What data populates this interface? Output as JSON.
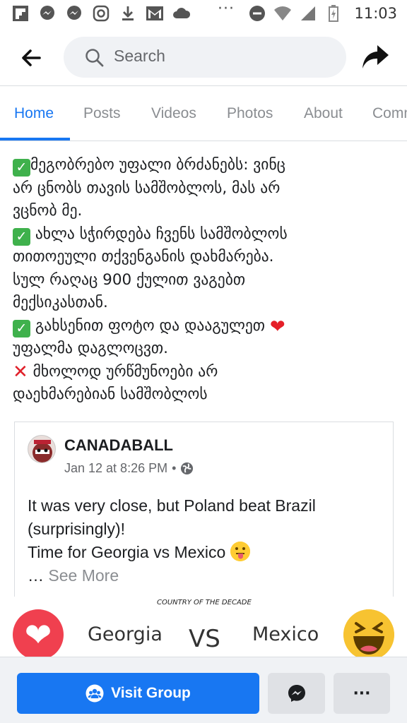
{
  "status_bar": {
    "time": "11:03",
    "dots": "···",
    "left_icons": [
      "flipboard-icon",
      "messenger-icon",
      "messenger-icon",
      "instagram-icon",
      "download-icon",
      "gmail-icon",
      "cloud-icon"
    ],
    "right_icons": [
      "do-not-disturb-icon",
      "wifi-icon",
      "signal-icon",
      "battery-icon"
    ]
  },
  "header": {
    "search_placeholder": "Search"
  },
  "tabs": [
    "Home",
    "Posts",
    "Videos",
    "Photos",
    "About",
    "Comm"
  ],
  "post": {
    "lines": [
      "მეგობრებო უფალი ბრძანებს: ვინც",
      "არ ცნობს თავის სამშობლოს, მას არ",
      "ვცნობ მე.",
      " ახლა სჭირდება ჩვენს სამშობლოს",
      "თითოეული თქვენგანის დახმარება.",
      "სულ რაღაც 900 ქულით ვაგებთ",
      "მექსიკასთან.",
      " გახსენით ფოტო და დააგულეთ ",
      "უფალმა დაგლოცვთ.",
      " მხოლოდ ურწმუნოები არ",
      "დაეხმარებიან სამშობლოს"
    ]
  },
  "shared_card": {
    "author": "CANADABALL",
    "date": "Jan 12 at 8:26 PM",
    "separator": "•",
    "body_line1": "It was very close, but Poland beat Brazil",
    "body_line2": "(surprisingly)!",
    "body_line3": "Time for Georgia vs Mexico",
    "ellipsis": "…",
    "see_more": "See More"
  },
  "image_strip": {
    "caption": "COUNTRY OF THE DECADE",
    "left_team": "Georgia",
    "vs": "VS",
    "right_team": "Mexico"
  },
  "bottom_bar": {
    "visit_group_label": "Visit Group",
    "more_label": "···"
  },
  "colors": {
    "accent": "#1877f2",
    "heart": "#f0404f",
    "check_green": "#3fb14c",
    "cross_red": "#e0202a"
  }
}
